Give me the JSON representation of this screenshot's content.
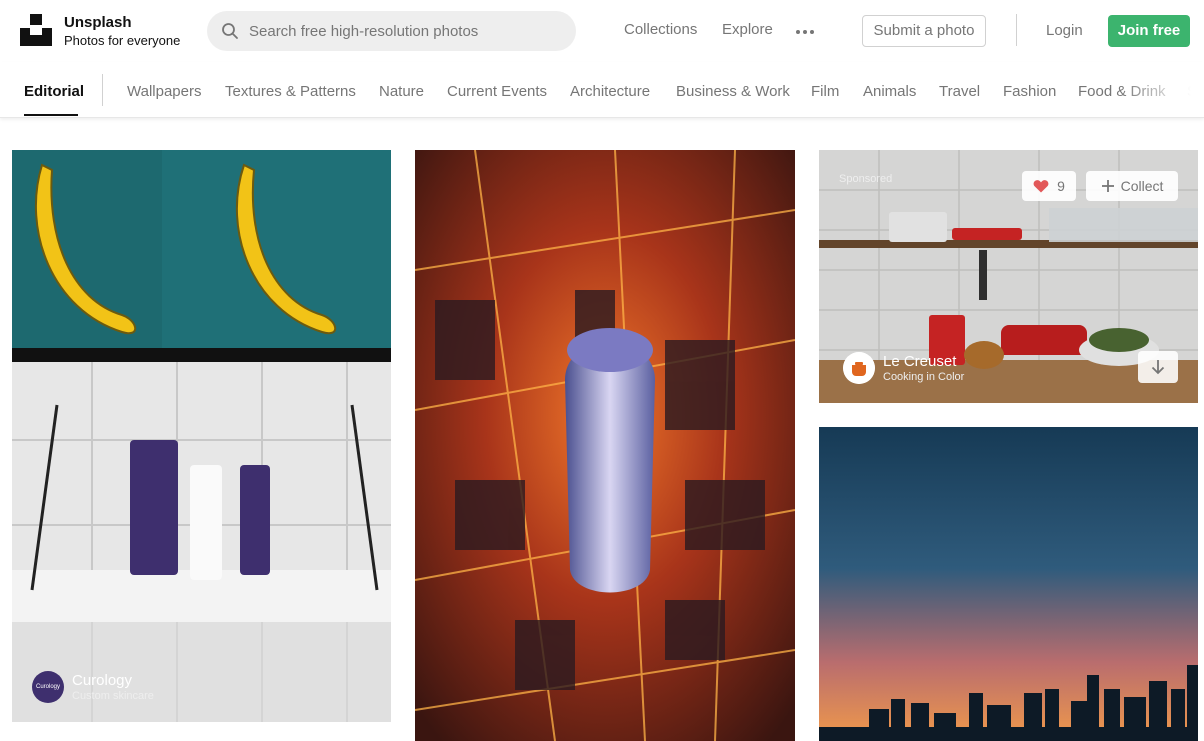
{
  "brand": {
    "name": "Unsplash",
    "tagline": "Photos for everyone"
  },
  "search": {
    "placeholder": "Search free high-resolution photos"
  },
  "nav": {
    "collections": "Collections",
    "explore": "Explore",
    "submit": "Submit a photo",
    "login": "Login",
    "join": "Join free"
  },
  "categories": [
    "Editorial",
    "Wallpapers",
    "Textures & Patterns",
    "Nature",
    "Current Events",
    "Architecture",
    "Business & Work",
    "Film",
    "Animals",
    "Travel",
    "Fashion",
    "Food & Drink",
    "Sp"
  ],
  "photos": [
    {
      "author": "Curology",
      "subtitle": "Custom skincare",
      "avatar_text": "Curology"
    },
    {
      "alt": "Aerial city at night"
    },
    {
      "sponsored": "Sponsored",
      "likes": "9",
      "collect": "Collect",
      "author": "Le Creuset",
      "subtitle": "Cooking in Color"
    },
    {
      "alt": "City skyline at dusk"
    }
  ],
  "colors": {
    "accent": "#3cb46e",
    "heart": "#e25859"
  }
}
